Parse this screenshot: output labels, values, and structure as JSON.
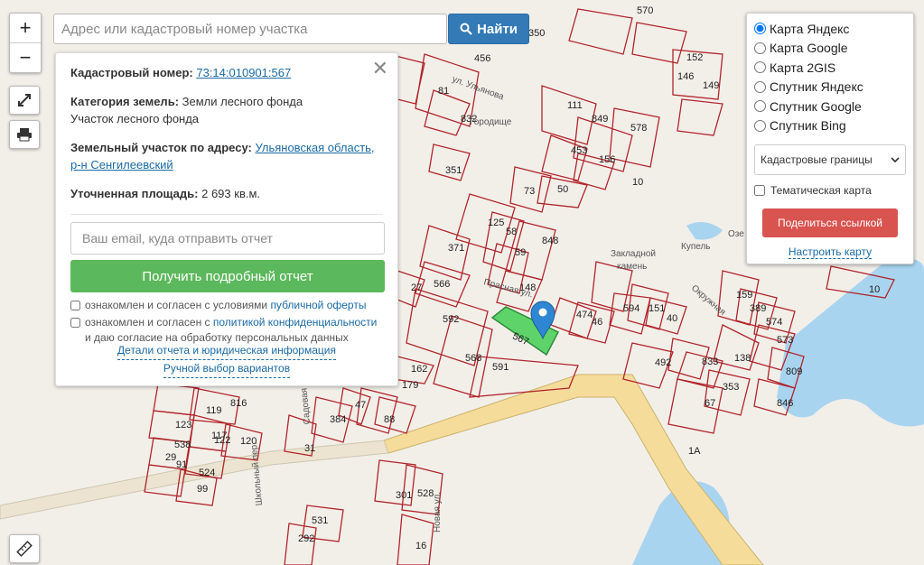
{
  "search": {
    "placeholder": "Адрес или кадастровый номер участка",
    "button_label": "Найти"
  },
  "zoom": {
    "in_label": "+",
    "out_label": "−"
  },
  "info": {
    "cadastral_label": "Кадастровый номер:",
    "cadastral_value": "73:14:010901:567",
    "category_label": "Категория земель:",
    "category_value": "Земли лесного фонда",
    "category_sub": "Участок лесного фонда",
    "address_label": "Земельный участок по адресу:",
    "address_value_line1": "Ульяновская область,",
    "address_value_line2": "р-н Сенгилеевский",
    "area_label": "Уточненная площадь:",
    "area_value": "2 693 кв.м.",
    "email_placeholder": "Ваш email, куда отправить отчет",
    "report_button": "Получить подробный отчет",
    "consent1_prefix": "ознакомлен и согласен с условиями ",
    "consent1_link": "публичной оферты",
    "consent2_prefix": "ознакомлен и согласен с ",
    "consent2_link": "политикой конфиденциальности",
    "consent2_suffix": " и даю согласие на обработку персональных данных",
    "link_details": "Детали отчета и юридическая информация",
    "link_manual": "Ручной выбор вариантов"
  },
  "layers": {
    "options": [
      "Карта Яндекс",
      "Карта Google",
      "Карта 2GIS",
      "Спутник Яндекс",
      "Спутник Google",
      "Спутник Bing"
    ],
    "selected_index": 0,
    "select_value": "Кадастровые границы",
    "thematic_label": "Тематическая карта",
    "share_button": "Поделиться ссылкой",
    "setup_link": "Настроить карту"
  },
  "map": {
    "colors": {
      "background": "#f2efe9",
      "parcel_stroke": "#b2252b",
      "highlight": "#5ed36a",
      "road": "#f5dc9b",
      "water": "#a9d4f0",
      "marker": "#2f86d3"
    },
    "highlight_label": "567",
    "place_labels": [
      "Закладной",
      "камень",
      "Купель",
      "Озе",
      "Городище"
    ],
    "streets": [
      "ул. Ульянова",
      "Новая ул.",
      "Школьный пер.",
      "Садовая ул.",
      "Окружная",
      "Прасная ул."
    ],
    "parcel_labels": [
      "570",
      "152",
      "146",
      "149",
      "81",
      "832",
      "456",
      "350",
      "111",
      "849",
      "578",
      "453",
      "156",
      "351",
      "73",
      "50",
      "125",
      "371",
      "58",
      "848",
      "59",
      "148",
      "566",
      "592",
      "568",
      "591",
      "474",
      "46",
      "594",
      "151",
      "40",
      "492",
      "833",
      "67",
      "353",
      "159",
      "389",
      "574",
      "573",
      "809",
      "138",
      "846",
      "10",
      "162",
      "816",
      "119",
      "123",
      "117",
      "538",
      "122",
      "120",
      "91",
      "524",
      "29",
      "99",
      "301",
      "528",
      "531",
      "292",
      "16",
      "31",
      "88",
      "384",
      "27",
      "47",
      "179",
      "1A",
      "10"
    ]
  }
}
